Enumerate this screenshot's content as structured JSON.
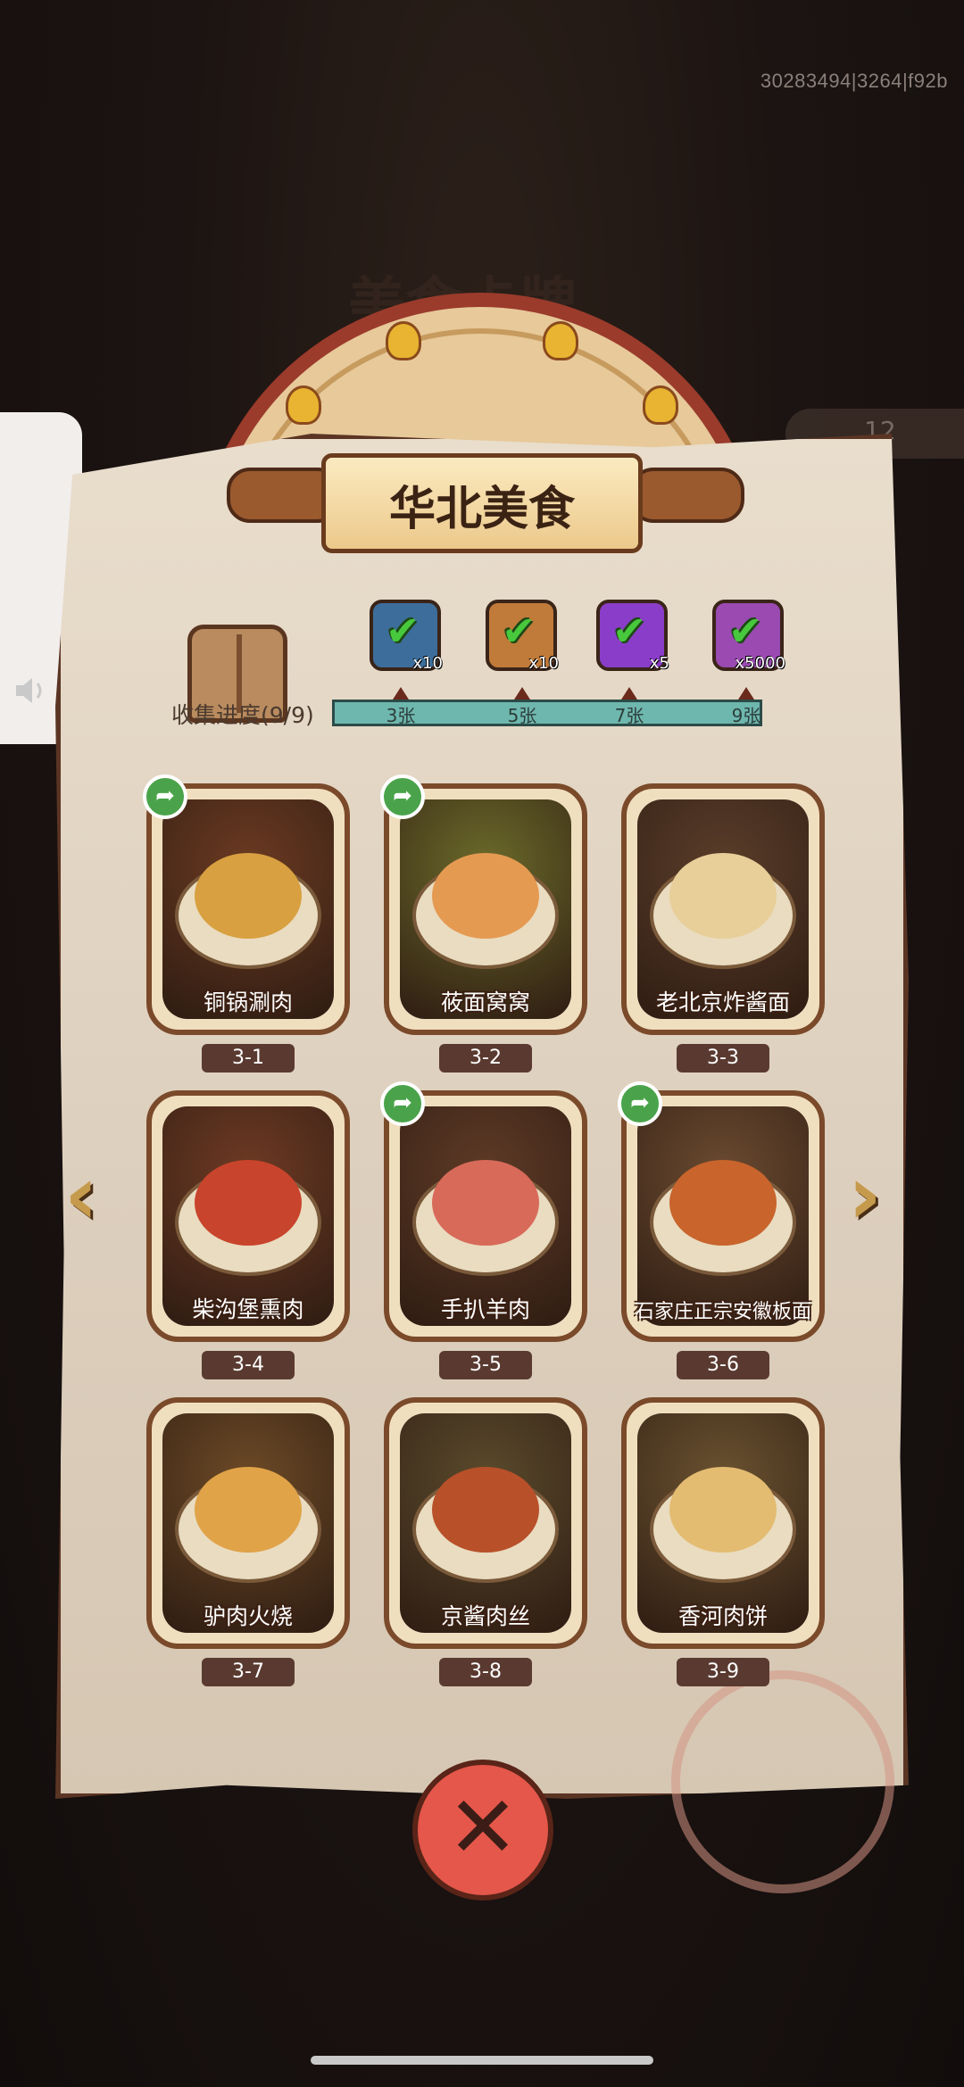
{
  "build_id": "30283494|3264|f92b",
  "background_title": "美食卡牌",
  "side_counter": "12",
  "panel_title": "华北美食",
  "collection": {
    "label": "收集进度(9/9)",
    "progress": 1.0,
    "ticks": [
      "3张",
      "5张",
      "7张",
      "9张"
    ],
    "rewards": [
      {
        "icon": "treasure-chest-icon",
        "qty": "x10",
        "color": "#3d6d9a"
      },
      {
        "icon": "scroll-icon",
        "qty": "x10",
        "color": "#c07a3a"
      },
      {
        "icon": "gem-orb-icon",
        "qty": "x5",
        "color": "#8a3dc8"
      },
      {
        "icon": "crystal-icon",
        "qty": "x5000",
        "color": "#9a4ab0"
      }
    ]
  },
  "cards": [
    {
      "name": "铜锅涮肉",
      "num": "3-1",
      "shared": true,
      "bg": "#6b3a22",
      "dish": "#d8a040"
    },
    {
      "name": "莜面窝窝",
      "num": "3-2",
      "shared": true,
      "bg": "#6b6a2a",
      "dish": "#e59a52"
    },
    {
      "name": "老北京炸酱面",
      "num": "3-3",
      "shared": false,
      "bg": "#5a3d2a",
      "dish": "#e8cf9a"
    },
    {
      "name": "柴沟堡熏肉",
      "num": "3-4",
      "shared": false,
      "bg": "#6e3a24",
      "dish": "#c9442c"
    },
    {
      "name": "手扒羊肉",
      "num": "3-5",
      "shared": true,
      "bg": "#5e3a26",
      "dish": "#d86a5a"
    },
    {
      "name": "石家庄正宗安徽板面",
      "num": "3-6",
      "shared": true,
      "bg": "#6a4a30",
      "dish": "#c8642c"
    },
    {
      "name": "驴肉火烧",
      "num": "3-7",
      "shared": false,
      "bg": "#6c4a26",
      "dish": "#e0a348"
    },
    {
      "name": "京酱肉丝",
      "num": "3-8",
      "shared": false,
      "bg": "#5a4a2c",
      "dish": "#b8502a"
    },
    {
      "name": "香河肉饼",
      "num": "3-9",
      "shared": false,
      "bg": "#6a5230",
      "dish": "#e3bc72"
    }
  ]
}
